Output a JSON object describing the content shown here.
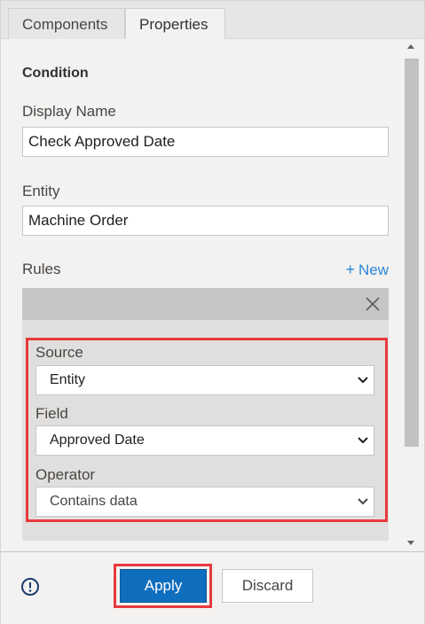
{
  "tabs": [
    {
      "label": "Components",
      "active": false
    },
    {
      "label": "Properties",
      "active": true
    }
  ],
  "section": {
    "title": "Condition"
  },
  "display_name": {
    "label": "Display Name",
    "value": "Check Approved Date"
  },
  "entity": {
    "label": "Entity",
    "value": "Machine Order"
  },
  "rules": {
    "label": "Rules",
    "new_label": "New",
    "new_icon": "plus-icon"
  },
  "rule": {
    "source": {
      "label": "Source",
      "value": "Entity"
    },
    "field": {
      "label": "Field",
      "value": "Approved Date"
    },
    "operator": {
      "label": "Operator",
      "value": "Contains data"
    }
  },
  "footer": {
    "info_icon": "info-icon",
    "apply_label": "Apply",
    "discard_label": "Discard"
  },
  "colors": {
    "accent": "#106ebe",
    "link": "#2b88d8",
    "highlight": "#e8393d"
  }
}
